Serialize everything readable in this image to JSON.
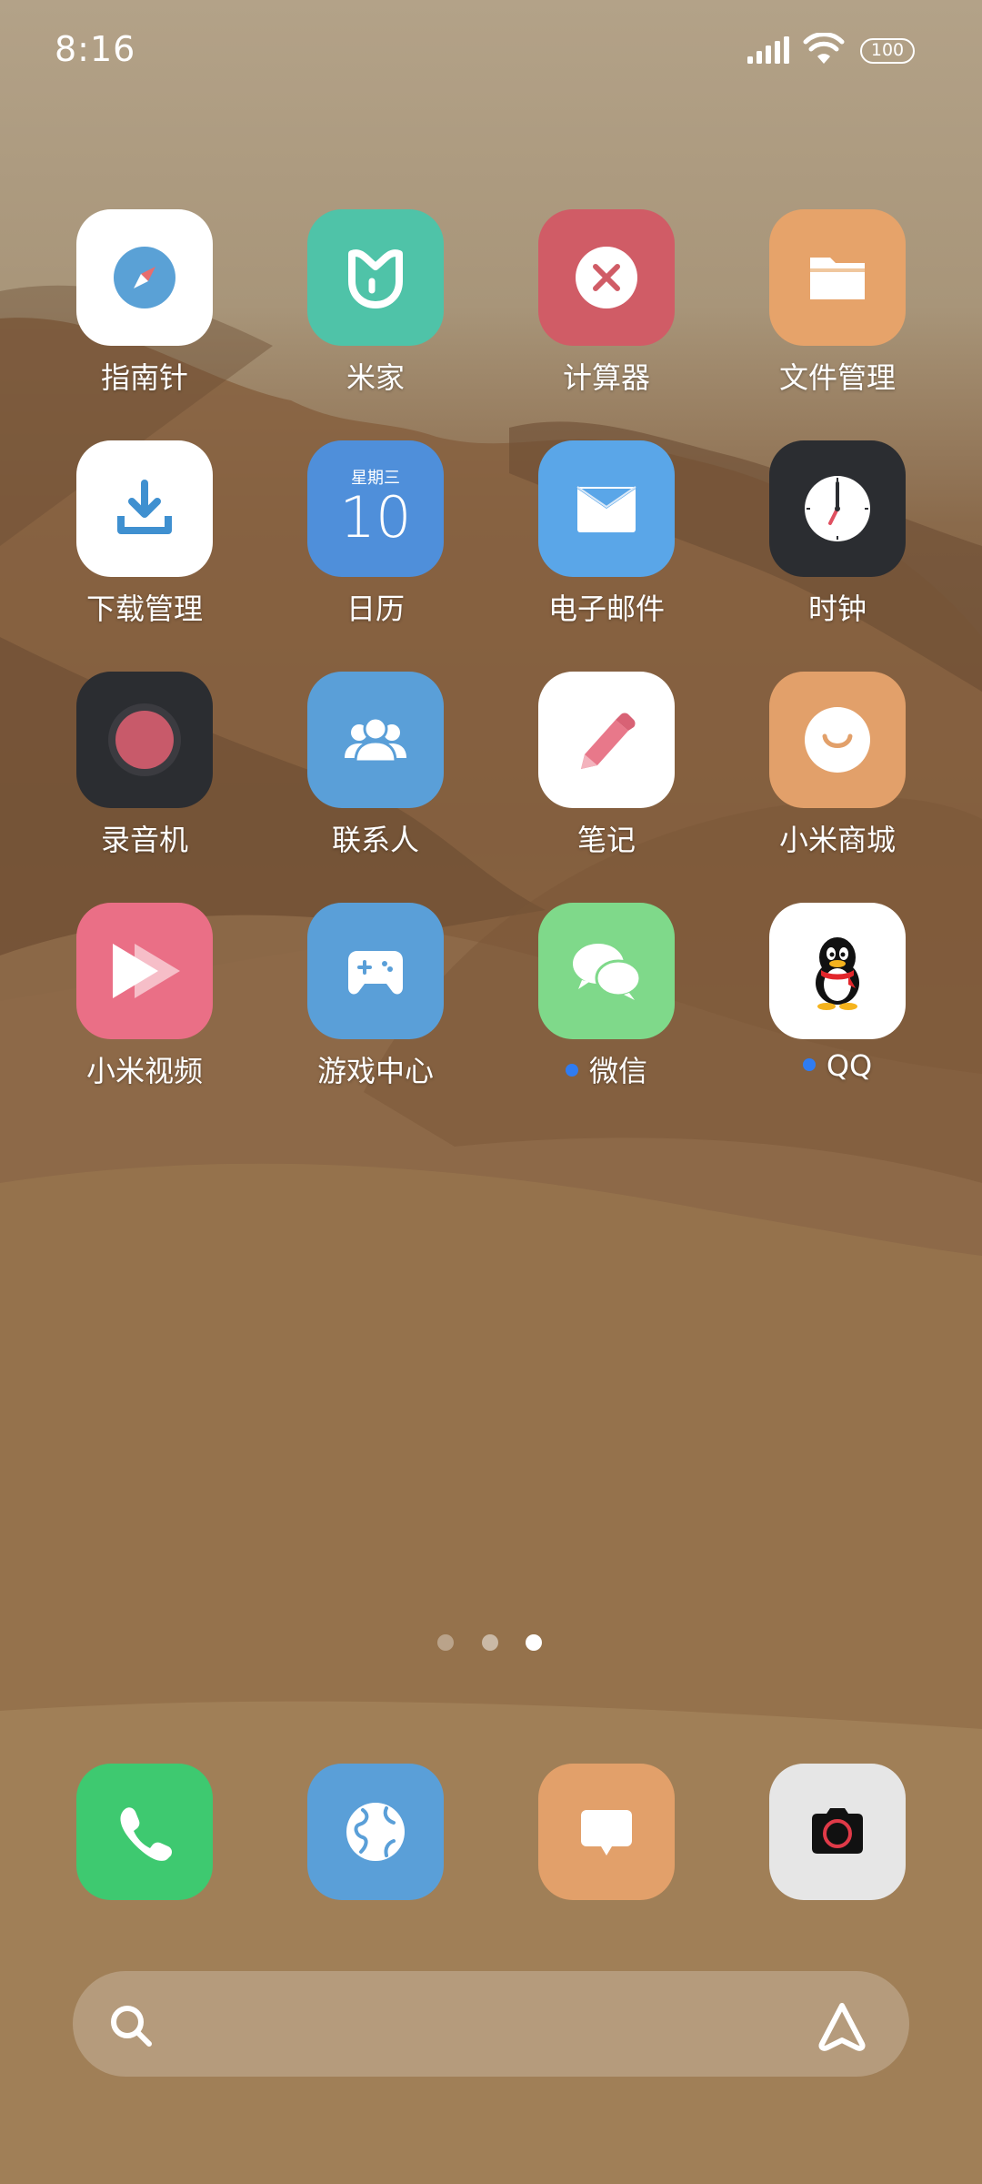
{
  "status_bar": {
    "time": "8:16",
    "battery_level": "100"
  },
  "home_grid": [
    {
      "name": "compass",
      "label": "指南针",
      "icon": "compass-icon",
      "color": "#ffffff"
    },
    {
      "name": "mijia",
      "label": "米家",
      "icon": "mijia-icon",
      "color": "#4fc3a8"
    },
    {
      "name": "calculator",
      "label": "计算器",
      "icon": "calculator-icon",
      "color": "#d05c66"
    },
    {
      "name": "file-manager",
      "label": "文件管理",
      "icon": "folder-icon",
      "color": "#e6a36a"
    },
    {
      "name": "download-manager",
      "label": "下载管理",
      "icon": "download-icon",
      "color": "#ffffff"
    },
    {
      "name": "calendar",
      "label": "日历",
      "icon": "calendar-icon",
      "color": "#4f8fda",
      "weekday": "星期三",
      "day": "10"
    },
    {
      "name": "email",
      "label": "电子邮件",
      "icon": "mail-icon",
      "color": "#5aa6e8"
    },
    {
      "name": "clock",
      "label": "时钟",
      "icon": "clock-icon",
      "color": "#2b2d31"
    },
    {
      "name": "recorder",
      "label": "录音机",
      "icon": "recorder-icon",
      "color": "#2b2d31"
    },
    {
      "name": "contacts",
      "label": "联系人",
      "icon": "contacts-icon",
      "color": "#5a9fd8"
    },
    {
      "name": "notes",
      "label": "笔记",
      "icon": "pencil-icon",
      "color": "#ffffff"
    },
    {
      "name": "mi-store",
      "label": "小米商城",
      "icon": "smile-icon",
      "color": "#e2a06a"
    },
    {
      "name": "mi-video",
      "label": "小米视频",
      "icon": "play-icon",
      "color": "#ea6f86"
    },
    {
      "name": "game-center",
      "label": "游戏中心",
      "icon": "gamepad-icon",
      "color": "#5a9fd8"
    },
    {
      "name": "wechat",
      "label": "微信",
      "icon": "wechat-icon",
      "color": "#7fd98a",
      "badge": true
    },
    {
      "name": "qq",
      "label": "QQ",
      "icon": "qq-penguin-icon",
      "color": "#ffffff",
      "badge": true
    }
  ],
  "dock": [
    {
      "name": "phone",
      "icon": "phone-icon",
      "color": "#3ec970"
    },
    {
      "name": "browser",
      "icon": "globe-icon",
      "color": "#5a9fd8"
    },
    {
      "name": "messages",
      "icon": "message-icon",
      "color": "#e2a06a"
    },
    {
      "name": "camera",
      "icon": "camera-icon",
      "color": "#e6e6e6"
    }
  ],
  "page_indicator": {
    "pages": 3,
    "current": 3
  },
  "search_bar": {
    "left_icon": "search-icon",
    "right_icon": "assistant-icon"
  }
}
